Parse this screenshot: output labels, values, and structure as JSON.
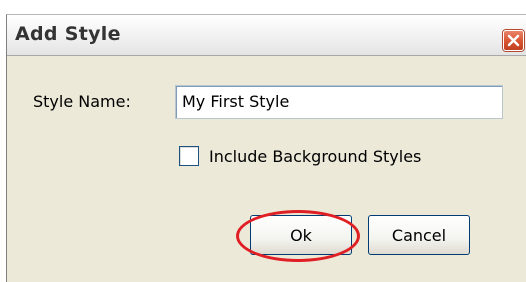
{
  "window": {
    "title": "Add Style",
    "close_icon": "close-icon"
  },
  "form": {
    "style_name_label": "Style Name:",
    "style_name_value": "My First Style",
    "include_background_label": "Include Background Styles",
    "include_background_checked": false
  },
  "buttons": {
    "ok_label": "Ok",
    "cancel_label": "Cancel"
  },
  "annotation": {
    "highlight_color": "#e01f25",
    "highlighted": "ok-button"
  },
  "colors": {
    "dialog_background": "#ece9d8",
    "close_button": "#d9532f",
    "button_border": "#003c74"
  }
}
